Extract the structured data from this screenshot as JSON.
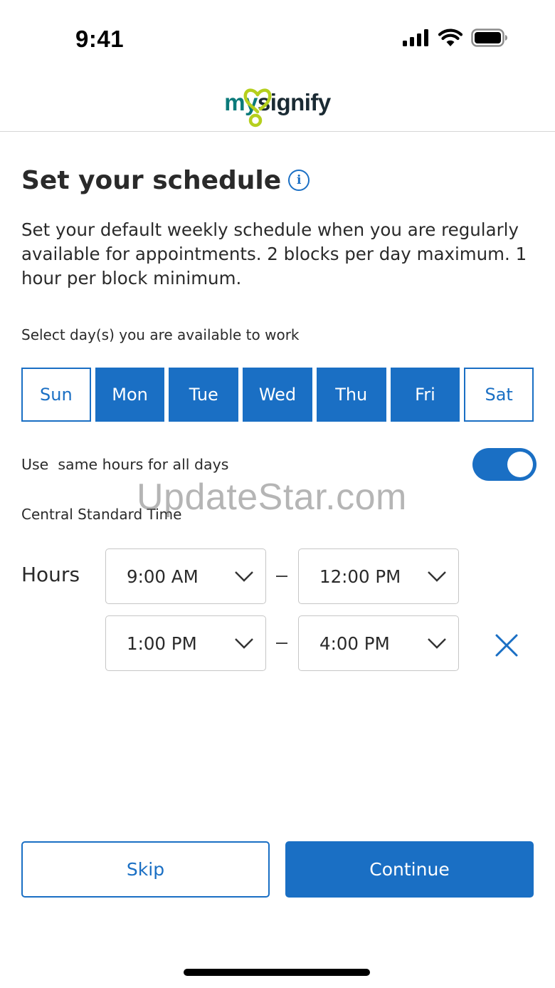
{
  "status_bar": {
    "time": "9:41",
    "icons": [
      "cellular-signal-icon",
      "wifi-icon",
      "battery-icon"
    ]
  },
  "header": {
    "logo_my": "my",
    "logo_signify": "signify",
    "logo_colors": {
      "my": "#0a7a7a",
      "mark": "#b5cf1d",
      "signify": "#1a2a33"
    }
  },
  "page": {
    "title": "Set your schedule",
    "info_icon_glyph": "i",
    "description": "Set your default weekly schedule when you are regularly available for appointments. 2 blocks per day maximum. 1 hour per block minimum."
  },
  "days": {
    "label": "Select day(s) you are available to work",
    "items": [
      {
        "label": "Sun",
        "selected": false
      },
      {
        "label": "Mon",
        "selected": true
      },
      {
        "label": "Tue",
        "selected": true
      },
      {
        "label": "Wed",
        "selected": true
      },
      {
        "label": "Thu",
        "selected": true
      },
      {
        "label": "Fri",
        "selected": true
      },
      {
        "label": "Sat",
        "selected": false
      }
    ]
  },
  "same_hours": {
    "label": "Use  same hours for all days",
    "enabled": true
  },
  "watermark": "UpdateStar.com",
  "timezone": "Central Standard Time",
  "hours": {
    "label": "Hours",
    "blocks": [
      {
        "start": "9:00 AM",
        "end": "12:00 PM"
      },
      {
        "start": "1:00 PM",
        "end": "4:00 PM"
      }
    ]
  },
  "actions": {
    "skip_label": "Skip",
    "continue_label": "Continue"
  },
  "colors": {
    "accent": "#1a6fc4",
    "text": "#2a2a2a",
    "border": "#c6c6c6"
  }
}
